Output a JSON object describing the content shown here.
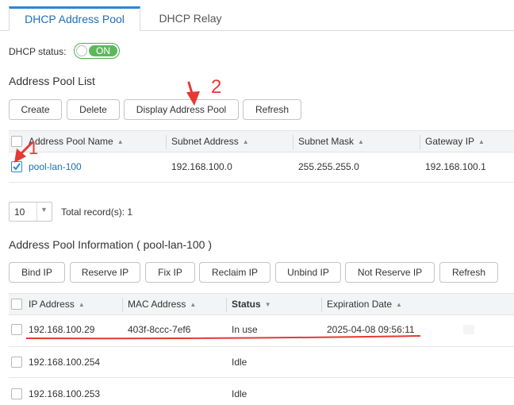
{
  "tabs": [
    {
      "label": "DHCP Address Pool",
      "active": true
    },
    {
      "label": "DHCP Relay",
      "active": false
    }
  ],
  "dhcp_status": {
    "label": "DHCP status:",
    "toggle_label": "ON",
    "on": true
  },
  "pool_list": {
    "title": "Address Pool List",
    "buttons": [
      "Create",
      "Delete",
      "Display Address Pool",
      "Refresh"
    ],
    "columns": [
      "Address Pool Name",
      "Subnet Address",
      "Subnet Mask",
      "Gateway IP"
    ],
    "rows": [
      {
        "name": "pool-lan-100",
        "subnet": "192.168.100.0",
        "mask": "255.255.255.0",
        "gateway": "192.168.100.1",
        "checked": true
      }
    ],
    "page_size": "10",
    "total_records": "Total record(s): 1"
  },
  "annotations": {
    "marker_1": "1",
    "marker_2": "2",
    "arrow_color": "#e53935"
  },
  "pool_info": {
    "title": "Address Pool Information ( pool-lan-100 )",
    "buttons": [
      "Bind IP",
      "Reserve IP",
      "Fix IP",
      "Reclaim IP",
      "Unbind IP",
      "Not Reserve IP",
      "Refresh"
    ],
    "columns": [
      "IP Address",
      "MAC Address",
      "Status",
      "Expiration Date"
    ],
    "rows": [
      {
        "ip": "192.168.100.29",
        "mac": "403f-8ccc-7ef6",
        "status": "In use",
        "expiration": "2025-04-08 09:56:11"
      },
      {
        "ip": "192.168.100.254",
        "mac": "",
        "status": "Idle",
        "expiration": ""
      },
      {
        "ip": "192.168.100.253",
        "mac": "",
        "status": "Idle",
        "expiration": ""
      }
    ]
  },
  "colors": {
    "accent": "#2b86d6",
    "toggle_on": "#5cb85c",
    "annotation_red": "#e53935",
    "link": "#1e6fb8"
  }
}
